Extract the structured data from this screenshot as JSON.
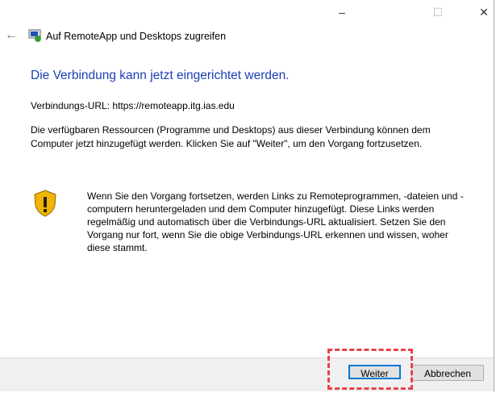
{
  "window": {
    "title": "Auf RemoteApp und Desktops zugreifen",
    "minimize": "–",
    "maximize": "☐",
    "close": "✕",
    "back": "←"
  },
  "heading": "Die Verbindung kann jetzt eingerichtet werden.",
  "url_line": "Verbindungs-URL: https://remoteapp.itg.ias.edu",
  "paragraph": "Die verfügbaren Ressourcen (Programme und Desktops) aus dieser Verbindung können dem Computer jetzt hinzugefügt werden. Klicken Sie auf \"Weiter\", um den Vorgang fortzusetzen.",
  "warning": "Wenn Sie den Vorgang fortsetzen, werden Links zu Remoteprogrammen, -dateien und -computern heruntergeladen und dem Computer hinzugefügt. Diese Links werden regelmäßig und automatisch über die Verbindungs-URL aktualisiert. Setzen Sie den Vorgang nur fort, wenn Sie die obige Verbindungs-URL erkennen und wissen, woher diese stammt.",
  "buttons": {
    "next": "Weiter",
    "cancel": "Abbrechen"
  },
  "colors": {
    "heading": "#1a3fb3",
    "highlight": "#e8424a",
    "focus": "#0078d7"
  }
}
